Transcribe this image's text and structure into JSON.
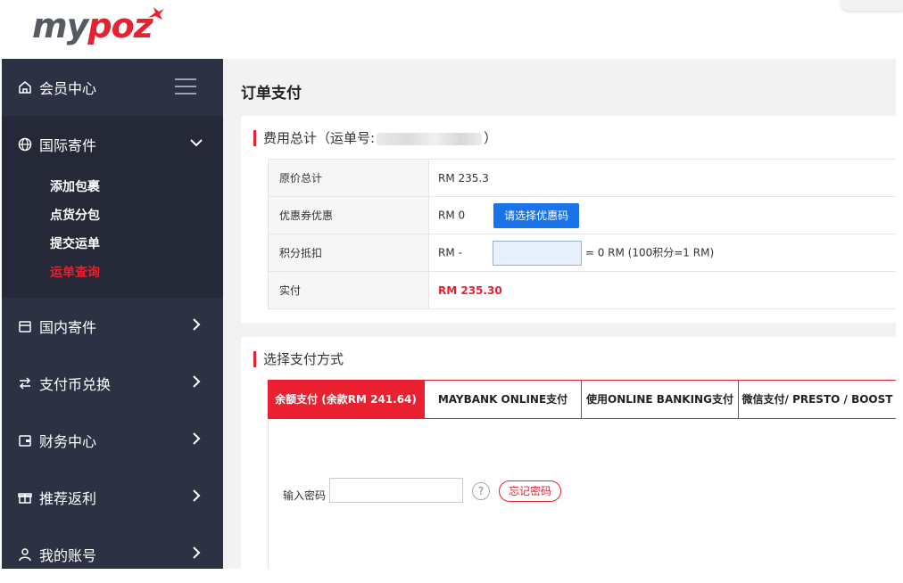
{
  "brand": {
    "logo_text_my": "my",
    "logo_text_poz": "poz"
  },
  "sidebar": {
    "member": {
      "label": "会员中心",
      "icon": "home-icon"
    },
    "groups": [
      {
        "label": "国际寄件",
        "icon": "globe-icon",
        "expanded": true,
        "items": [
          {
            "label": "添加包裹"
          },
          {
            "label": "点货分包"
          },
          {
            "label": "提交运单"
          },
          {
            "label": "运单查询",
            "current": true
          }
        ]
      },
      {
        "label": "国内寄件",
        "icon": "box-icon"
      },
      {
        "label": "支付币兑换",
        "icon": "exchange-icon"
      },
      {
        "label": "财务中心",
        "icon": "wallet-icon"
      },
      {
        "label": "推荐返利",
        "icon": "gift-icon"
      },
      {
        "label": "我的账号",
        "icon": "user-icon"
      }
    ]
  },
  "page": {
    "title": "订单支付"
  },
  "fees": {
    "section_title_prefix": "费用总计（运单号:",
    "section_title_suffix": "）",
    "rows": {
      "original": {
        "label": "原价总计",
        "value": "RM  235.3"
      },
      "coupon": {
        "label": "优惠券优惠",
        "value": "RM  0",
        "button": "请选择优惠码"
      },
      "points": {
        "label": "积分抵扣",
        "value": "RM  -",
        "suffix": "= 0 RM   (100积分=1 RM)"
      },
      "paid": {
        "label": "实付",
        "value": "RM 235.30"
      }
    }
  },
  "payment": {
    "section_title": "选择支付方式",
    "tabs": [
      {
        "label": "余额支付 (余款RM 241.64)",
        "active": true
      },
      {
        "label": "MAYBANK ONLINE支付"
      },
      {
        "label": "使用ONLINE BANKING支付"
      },
      {
        "label": "微信支付/ PRESTO / BOOST"
      }
    ],
    "password_label": "输入密码",
    "password_value": "",
    "help_symbol": "?",
    "forgot_label": "忘记密码"
  },
  "colors": {
    "accent": "#e8202f",
    "sidebar": "#2d3144",
    "sidebar_active": "#252836",
    "blue": "#1a73e8"
  }
}
